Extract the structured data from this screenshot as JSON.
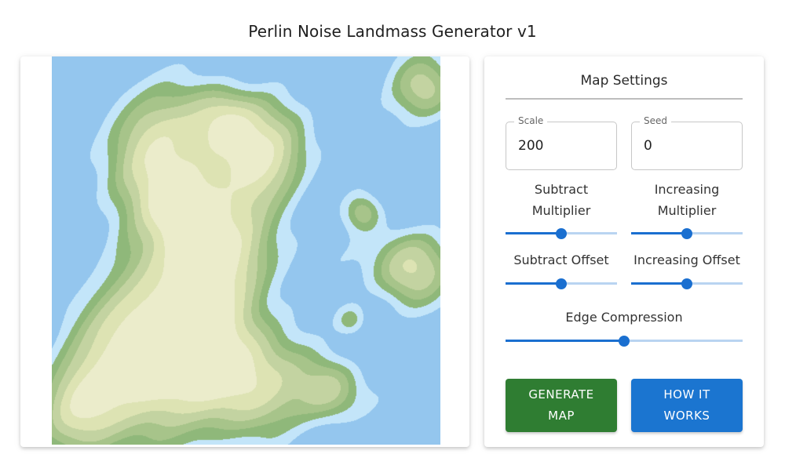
{
  "app": {
    "title": "Perlin Noise Landmass Generator v1"
  },
  "settings": {
    "title": "Map Settings",
    "scale": {
      "label": "Scale",
      "value": "200"
    },
    "seed": {
      "label": "Seed",
      "value": "0"
    },
    "sliders": {
      "subtract_multiplier": {
        "label": "Subtract Multiplier",
        "value": 0.5
      },
      "increasing_multiplier": {
        "label": "Increasing Multiplier",
        "value": 0.5
      },
      "subtract_offset": {
        "label": "Subtract Offset",
        "value": 0.5
      },
      "increasing_offset": {
        "label": "Increasing Offset",
        "value": 0.5
      },
      "edge_compression": {
        "label": "Edge Compression",
        "value": 0.5
      }
    },
    "buttons": {
      "generate": "GENERATE MAP",
      "how": "HOW IT WORKS"
    }
  },
  "colors": {
    "deep_water": "#94c6ee",
    "shallow_water": "#c3e5f9",
    "lowland": "#8fb87a",
    "lowland_2": "#a7c48a",
    "midland": "#c3d3a1",
    "highland": "#dde3b3",
    "peak": "#ebeccb",
    "accent_blue": "#1a6fd0",
    "generate_green": "#2f7d32"
  }
}
